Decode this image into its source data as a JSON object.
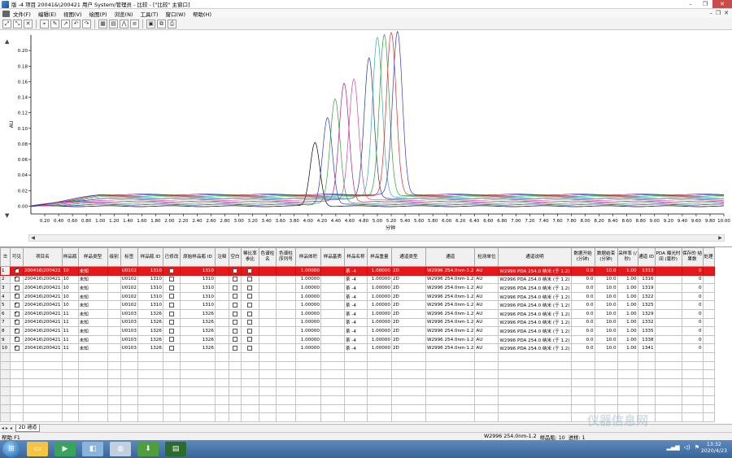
{
  "window": {
    "title": "版 -4 项目 20041&\\200421 用户 System/管理员 - 比较 - [\"比较\" 主窗口]",
    "controls": [
      "–",
      "❐",
      "✕"
    ]
  },
  "menubar": {
    "items": [
      "文件(F)",
      "编辑(E)",
      "视图(V)",
      "绘图(P)",
      "浏览(N)",
      "工具(T)",
      "窗口(W)",
      "帮助(H)"
    ],
    "mdi_controls": [
      "–",
      "❐",
      "✕"
    ]
  },
  "toolbar": {
    "buttons": [
      "zoom-in-icon",
      "zoom-out-icon",
      "delete-icon",
      "cursor-icon",
      "pen-icon",
      "arrow-icon",
      "undo-icon",
      "redo-icon",
      "grid-icon",
      "table-icon",
      "peak-icon",
      "stack-icon",
      "print-preview-icon",
      "copy-icon",
      "print-icon"
    ]
  },
  "chart_data": {
    "type": "line",
    "ylabel": "AU",
    "xlabel": "分钟",
    "xlim": [
      0.0,
      10.0
    ],
    "ylim": [
      -0.01,
      0.22
    ],
    "x_ticks": [
      "0.20",
      "0.40",
      "0.60",
      "0.80",
      "1.00",
      "1.20",
      "1.40",
      "1.60",
      "1.80",
      "2.00",
      "2.20",
      "2.40",
      "2.60",
      "2.80",
      "3.00",
      "3.20",
      "3.40",
      "3.60",
      "3.80",
      "4.00",
      "4.20",
      "4.40",
      "4.60",
      "4.80",
      "5.00",
      "5.20",
      "5.40",
      "5.60",
      "5.80",
      "6.00",
      "6.20",
      "6.40",
      "6.60",
      "6.80",
      "7.00",
      "7.20",
      "7.40",
      "7.60",
      "7.80",
      "8.00",
      "8.20",
      "8.40",
      "8.60",
      "8.80",
      "9.00",
      "9.20",
      "9.40",
      "9.60",
      "9.80",
      "10.00"
    ],
    "y_ticks": [
      "0.00",
      "0.02",
      "0.04",
      "0.06",
      "0.08",
      "0.10",
      "0.12",
      "0.14",
      "0.16",
      "0.18",
      "0.20"
    ],
    "series": [
      {
        "color": "#000000",
        "peak_time": 4.1,
        "peak_height": 0.082,
        "width": 0.07,
        "baseline": 0.0
      },
      {
        "color": "#1f3fbf",
        "peak_time": 4.28,
        "peak_height": 0.112,
        "width": 0.07,
        "baseline": 0.002
      },
      {
        "color": "#2e9e36",
        "peak_time": 4.39,
        "peak_height": 0.133,
        "width": 0.07,
        "baseline": 0.004
      },
      {
        "color": "#b2188c",
        "peak_time": 4.52,
        "peak_height": 0.152,
        "width": 0.07,
        "baseline": 0.006
      },
      {
        "color": "#e23c9b",
        "peak_time": 4.66,
        "peak_height": 0.156,
        "width": 0.07,
        "baseline": 0.008
      },
      {
        "color": "#1a3a90",
        "peak_time": 4.88,
        "peak_height": 0.18,
        "width": 0.07,
        "baseline": 0.01
      },
      {
        "color": "#2db0a4",
        "peak_time": 5.0,
        "peak_height": 0.205,
        "width": 0.07,
        "baseline": 0.012
      },
      {
        "color": "#2c9e2c",
        "peak_time": 5.1,
        "peak_height": 0.208,
        "width": 0.07,
        "baseline": 0.013
      },
      {
        "color": "#e0282a",
        "peak_time": 5.2,
        "peak_height": 0.209,
        "width": 0.07,
        "baseline": 0.014
      },
      {
        "color": "#3537c9",
        "peak_time": 5.29,
        "peak_height": 0.209,
        "width": 0.07,
        "baseline": 0.015
      }
    ]
  },
  "grid": {
    "headers": [
      "可见",
      "项目名",
      "样品瓶",
      "样品类型",
      "级别",
      "标签",
      "样品瓶 ID",
      "已修改",
      "原始样品瓶 ID",
      "注释",
      "空白",
      "稀比率 参比",
      "色谱柱 名",
      "色谱柱 序列号",
      "样品体积",
      "样品基质",
      "样品名称",
      "样品重量",
      "通道类型",
      "通道",
      "检测单位",
      "通道说明",
      "数据开始 (分钟)",
      "数据结束 (分钟)",
      "采样率 (/秒)",
      "通道 ID",
      "PDA 曝光时间 (毫秒)",
      "保存的 结果数",
      "处理"
    ],
    "rows": [
      {
        "n": "1",
        "proj": "200416\\200421",
        "vial": "10",
        "type": "未知",
        "label": "U0102",
        "vid": "1310",
        "ovid": "1310",
        "vol": "1.00000",
        "name": "茶 -4",
        "wt": "1.00000",
        "ctype": "2D",
        "chan": "W2996 254.0nm-1.2",
        "unit": "AU",
        "desc": "W2996 PDA 254.0 纳米 (于 1.2)",
        "start": "0.0",
        "end": "10.0",
        "rate": "1.00",
        "cid": "1313",
        "saved": "0"
      },
      {
        "n": "2",
        "proj": "200416\\200421",
        "vial": "10",
        "type": "未知",
        "label": "U0102",
        "vid": "1310",
        "ovid": "1310",
        "vol": "1.00000",
        "name": "茶 -4",
        "wt": "1.00000",
        "ctype": "2D",
        "chan": "W2996 254.0nm-1.2",
        "unit": "AU",
        "desc": "W2996 PDA 254.0 纳米 (于 1.2)",
        "start": "0.0",
        "end": "10.0",
        "rate": "1.00",
        "cid": "1316",
        "saved": "0"
      },
      {
        "n": "3",
        "proj": "200416\\200421",
        "vial": "10",
        "type": "未知",
        "label": "U0102",
        "vid": "1310",
        "ovid": "1310",
        "vol": "1.00000",
        "name": "茶 -4",
        "wt": "1.00000",
        "ctype": "2D",
        "chan": "W2996 254.0nm-1.2",
        "unit": "AU",
        "desc": "W2996 PDA 254.0 纳米 (于 1.2)",
        "start": "0.0",
        "end": "10.0",
        "rate": "1.00",
        "cid": "1319",
        "saved": "0"
      },
      {
        "n": "4",
        "proj": "200416\\200421",
        "vial": "10",
        "type": "未知",
        "label": "U0102",
        "vid": "1310",
        "ovid": "1310",
        "vol": "1.00000",
        "name": "茶 -4",
        "wt": "1.00000",
        "ctype": "2D",
        "chan": "W2996 254.0nm-1.2",
        "unit": "AU",
        "desc": "W2996 PDA 254.0 纳米 (于 1.2)",
        "start": "0.0",
        "end": "10.0",
        "rate": "1.00",
        "cid": "1322",
        "saved": "0"
      },
      {
        "n": "5",
        "proj": "200416\\200421",
        "vial": "10",
        "type": "未知",
        "label": "U0102",
        "vid": "1310",
        "ovid": "1310",
        "vol": "1.00000",
        "name": "茶 -4",
        "wt": "1.00000",
        "ctype": "2D",
        "chan": "W2996 254.0nm-1.2",
        "unit": "AU",
        "desc": "W2996 PDA 254.0 纳米 (于 1.2)",
        "start": "0.0",
        "end": "10.0",
        "rate": "1.00",
        "cid": "1325",
        "saved": "0"
      },
      {
        "n": "6",
        "proj": "200416\\200421",
        "vial": "11",
        "type": "未知",
        "label": "U0103",
        "vid": "1326",
        "ovid": "1326",
        "vol": "1.00000",
        "name": "茶 -4",
        "wt": "1.00000",
        "ctype": "2D",
        "chan": "W2996 254.0nm-1.2",
        "unit": "AU",
        "desc": "W2996 PDA 254.0 纳米 (于 1.2)",
        "start": "0.0",
        "end": "10.0",
        "rate": "1.00",
        "cid": "1329",
        "saved": "0"
      },
      {
        "n": "7",
        "proj": "200416\\200421",
        "vial": "11",
        "type": "未知",
        "label": "U0103",
        "vid": "1326",
        "ovid": "1326",
        "vol": "1.00000",
        "name": "茶 -4",
        "wt": "1.00000",
        "ctype": "2D",
        "chan": "W2996 254.0nm-1.2",
        "unit": "AU",
        "desc": "W2996 PDA 254.0 纳米 (于 1.2)",
        "start": "0.0",
        "end": "10.0",
        "rate": "1.00",
        "cid": "1332",
        "saved": "0"
      },
      {
        "n": "8",
        "proj": "200416\\200421",
        "vial": "11",
        "type": "未知",
        "label": "U0103",
        "vid": "1326",
        "ovid": "1326",
        "vol": "1.00000",
        "name": "茶 -4",
        "wt": "1.00000",
        "ctype": "2D",
        "chan": "W2996 254.0nm-1.2",
        "unit": "AU",
        "desc": "W2996 PDA 254.0 纳米 (于 1.2)",
        "start": "0.0",
        "end": "10.0",
        "rate": "1.00",
        "cid": "1335",
        "saved": "0"
      },
      {
        "n": "9",
        "proj": "200416\\200421",
        "vial": "11",
        "type": "未知",
        "label": "U0103",
        "vid": "1326",
        "ovid": "1326",
        "vol": "1.00000",
        "name": "茶 -4",
        "wt": "1.00000",
        "ctype": "2D",
        "chan": "W2996 254.0nm-1.2",
        "unit": "AU",
        "desc": "W2996 PDA 254.0 纳米 (于 1.2)",
        "start": "0.0",
        "end": "10.0",
        "rate": "1.00",
        "cid": "1338",
        "saved": "0"
      },
      {
        "n": "10",
        "proj": "200416\\200421",
        "vial": "11",
        "type": "未知",
        "label": "U0103",
        "vid": "1326",
        "ovid": "1326",
        "vol": "1.00000",
        "name": "茶 -4",
        "wt": "1.00000",
        "ctype": "2D",
        "chan": "W2996 254.0nm-1.2",
        "unit": "AU",
        "desc": "W2996 PDA 254.0 纳米 (于 1.2)",
        "start": "0.0",
        "end": "10.0",
        "rate": "1.00",
        "cid": "1341",
        "saved": "0"
      }
    ],
    "selected_row": 0,
    "empty_rows": 8
  },
  "sheet_tab": "2D 通道",
  "statusbar": {
    "help": "帮助 F1",
    "channel": "W2996 254.0nm-1.2",
    "vial": "样品瓶: 10",
    "inject": "进样: 1"
  },
  "taskbar": {
    "time": "13:32",
    "date": "2020/4/23"
  },
  "watermark": "仪器信息网"
}
